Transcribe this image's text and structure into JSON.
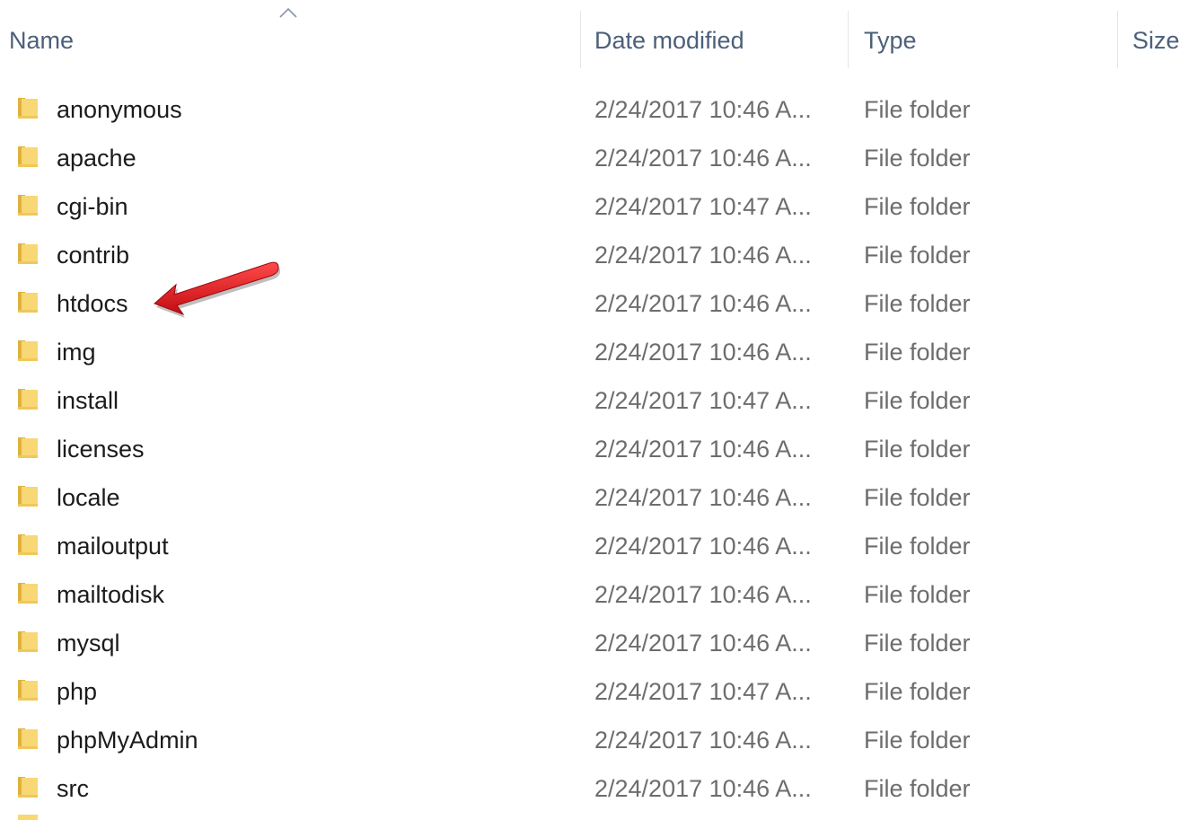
{
  "header": {
    "name_label": "Name",
    "date_label": "Date modified",
    "type_label": "Type",
    "size_label": "Size",
    "sort_indicator": "chevron-up-icon"
  },
  "rows": [
    {
      "name": "anonymous",
      "date": "2/24/2017 10:46 A...",
      "type": "File folder",
      "size": ""
    },
    {
      "name": "apache",
      "date": "2/24/2017 10:46 A...",
      "type": "File folder",
      "size": ""
    },
    {
      "name": "cgi-bin",
      "date": "2/24/2017 10:47 A...",
      "type": "File folder",
      "size": ""
    },
    {
      "name": "contrib",
      "date": "2/24/2017 10:46 A...",
      "type": "File folder",
      "size": ""
    },
    {
      "name": "htdocs",
      "date": "2/24/2017 10:46 A...",
      "type": "File folder",
      "size": ""
    },
    {
      "name": "img",
      "date": "2/24/2017 10:46 A...",
      "type": "File folder",
      "size": ""
    },
    {
      "name": "install",
      "date": "2/24/2017 10:47 A...",
      "type": "File folder",
      "size": ""
    },
    {
      "name": "licenses",
      "date": "2/24/2017 10:46 A...",
      "type": "File folder",
      "size": ""
    },
    {
      "name": "locale",
      "date": "2/24/2017 10:46 A...",
      "type": "File folder",
      "size": ""
    },
    {
      "name": "mailoutput",
      "date": "2/24/2017 10:46 A...",
      "type": "File folder",
      "size": ""
    },
    {
      "name": "mailtodisk",
      "date": "2/24/2017 10:46 A...",
      "type": "File folder",
      "size": ""
    },
    {
      "name": "mysql",
      "date": "2/24/2017 10:46 A...",
      "type": "File folder",
      "size": ""
    },
    {
      "name": "php",
      "date": "2/24/2017 10:47 A...",
      "type": "File folder",
      "size": ""
    },
    {
      "name": "phpMyAdmin",
      "date": "2/24/2017 10:46 A...",
      "type": "File folder",
      "size": ""
    },
    {
      "name": "src",
      "date": "2/24/2017 10:46 A...",
      "type": "File folder",
      "size": ""
    }
  ],
  "icons": {
    "row_icon": "folder-icon",
    "annotation": "red-arrow-icon"
  },
  "colors": {
    "header_text": "#4c607a",
    "name_text": "#1b1b1b",
    "detail_text": "#6d6d6d",
    "folder_yellow": "#f8d775",
    "folder_dark": "#e0b13c",
    "arrow_red": "#e0141b"
  }
}
